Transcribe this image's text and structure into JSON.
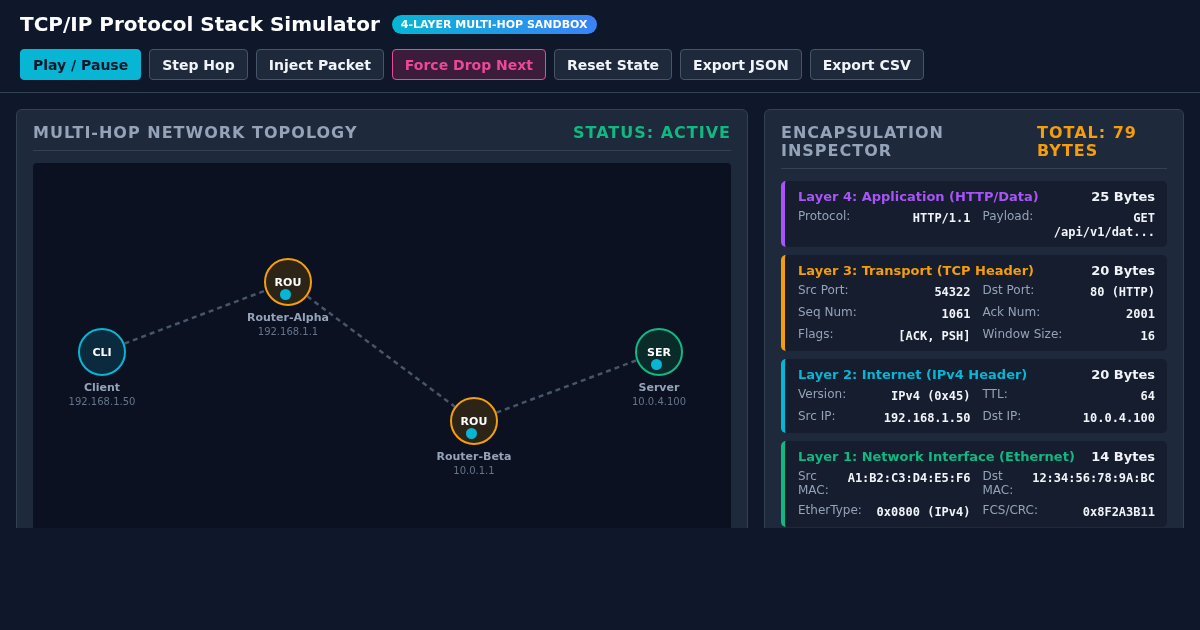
{
  "header": {
    "title": "TCP/IP Protocol Stack Simulator",
    "badge": "4-LAYER MULTI-HOP SANDBOX"
  },
  "buttons": [
    {
      "label": "Play / Pause",
      "kind": "primary"
    },
    {
      "label": "Step Hop",
      "kind": "default"
    },
    {
      "label": "Inject Packet",
      "kind": "default"
    },
    {
      "label": "Force Drop Next",
      "kind": "danger"
    },
    {
      "label": "Reset State",
      "kind": "default"
    },
    {
      "label": "Export JSON",
      "kind": "default"
    },
    {
      "label": "Export CSV",
      "kind": "default"
    }
  ],
  "topology": {
    "title": "MULTI-HOP NETWORK TOPOLOGY",
    "status": "STATUS: ACTIVE",
    "active": true,
    "nodes": [
      {
        "short": "CLI",
        "name": "Client",
        "ip": "192.168.1.50",
        "kind": "client",
        "packet": false
      },
      {
        "short": "ROU",
        "name": "Router-Alpha",
        "ip": "192.168.1.1",
        "kind": "router",
        "packet": true
      },
      {
        "short": "ROU",
        "name": "Router-Beta",
        "ip": "10.0.1.1",
        "kind": "router",
        "packet": true
      },
      {
        "short": "SER",
        "name": "Server",
        "ip": "10.0.4.100",
        "kind": "server",
        "packet": true
      }
    ]
  },
  "inspector": {
    "title": "ENCAPSULATION INSPECTOR",
    "total": "TOTAL: 79 BYTES",
    "layers": [
      {
        "title": "Layer 4: Application (HTTP/Data)",
        "size": "25 Bytes",
        "color": "#a855f7",
        "fields": [
          {
            "label": "Protocol:",
            "value": "HTTP/1.1"
          },
          {
            "label": "Payload:",
            "value": "GET /api/v1/dat..."
          }
        ]
      },
      {
        "title": "Layer 3: Transport (TCP Header)",
        "size": "20 Bytes",
        "color": "#f59e0b",
        "fields": [
          {
            "label": "Src Port:",
            "value": "54322"
          },
          {
            "label": "Dst Port:",
            "value": "80 (HTTP)"
          },
          {
            "label": "Seq Num:",
            "value": "1061"
          },
          {
            "label": "Ack Num:",
            "value": "2001"
          },
          {
            "label": "Flags:",
            "value": "[ACK, PSH]"
          },
          {
            "label": "Window Size:",
            "value": "16"
          }
        ]
      },
      {
        "title": "Layer 2: Internet (IPv4 Header)",
        "size": "20 Bytes",
        "color": "#06b6d4",
        "fields": [
          {
            "label": "Version:",
            "value": "IPv4 (0x45)"
          },
          {
            "label": "TTL:",
            "value": "64"
          },
          {
            "label": "Src IP:",
            "value": "192.168.1.50"
          },
          {
            "label": "Dst IP:",
            "value": "10.0.4.100"
          }
        ]
      },
      {
        "title": "Layer 1: Network Interface (Ethernet)",
        "size": "14 Bytes",
        "color": "#10b981",
        "fields": [
          {
            "label": "Src MAC:",
            "value": "A1:B2:C3:D4:E5:F6"
          },
          {
            "label": "Dst MAC:",
            "value": "12:34:56:78:9A:BC"
          },
          {
            "label": "EtherType:",
            "value": "0x0800 (IPv4)"
          },
          {
            "label": "FCS/CRC:",
            "value": "0x8F2A3B11"
          }
        ]
      }
    ]
  }
}
